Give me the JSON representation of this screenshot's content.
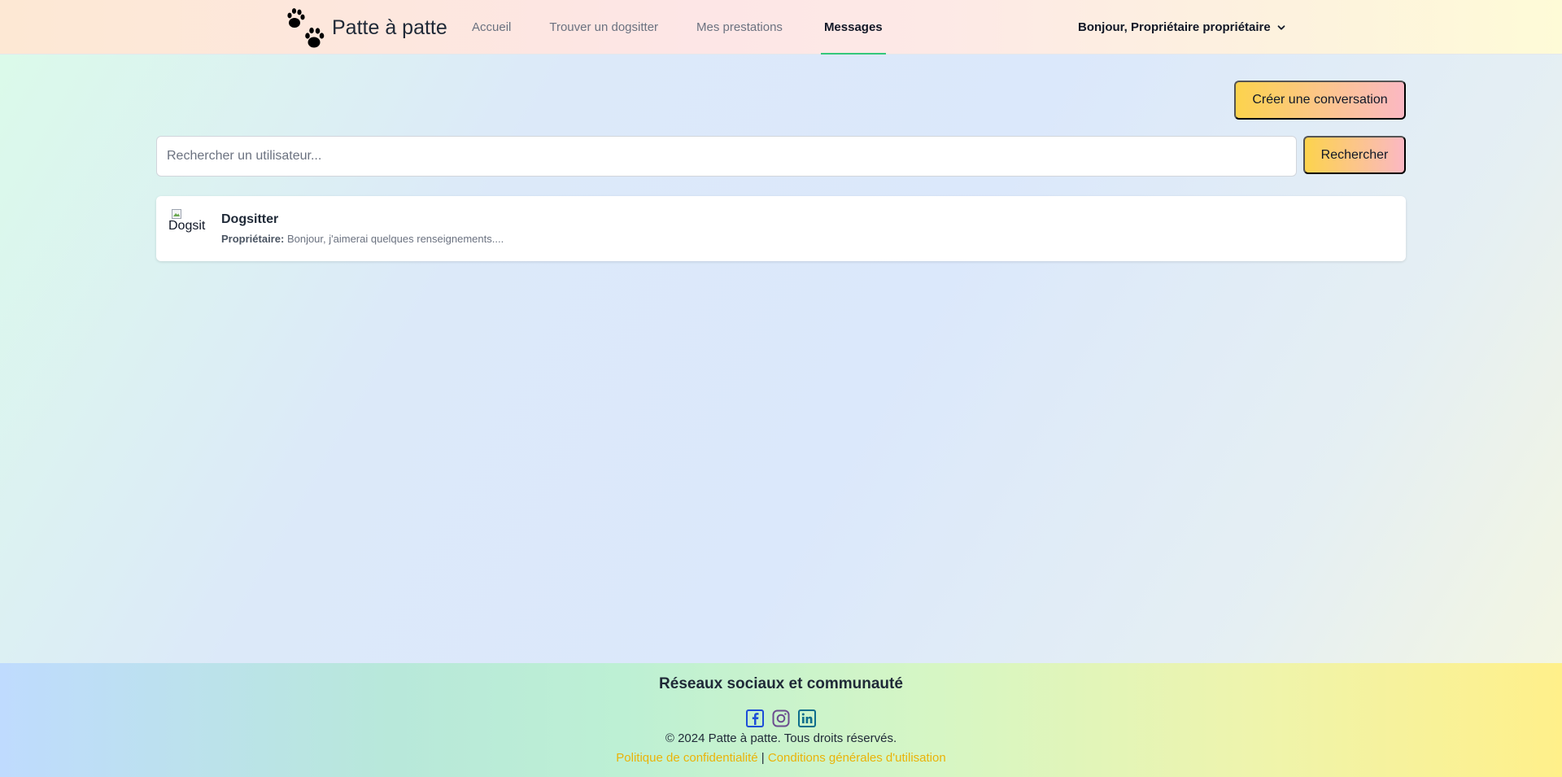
{
  "navbar": {
    "brand": "Patte à patte",
    "links": [
      {
        "label": "Accueil"
      },
      {
        "label": "Trouver un dogsitter"
      },
      {
        "label": "Mes prestations"
      },
      {
        "label": "Messages"
      }
    ],
    "active_link": "Messages",
    "user_greeting": "Bonjour, Propriétaire propriétaire"
  },
  "messages": {
    "create_button": "Créer une conversation",
    "search_placeholder": "Rechercher un utilisateur...",
    "search_button": "Rechercher",
    "conversations": [
      {
        "avatar_alt": "Dogsit",
        "name": "Dogsitter",
        "sender": "Propriétaire:",
        "preview": "Bonjour, j'aimerai quelques renseignements...."
      }
    ]
  },
  "footer": {
    "title": "Réseaux sociaux et communauté",
    "social": [
      "facebook-icon",
      "instagram-icon",
      "linkedin-icon"
    ],
    "copyright": "© 2024 Patte à patte. Tous droits réservés.",
    "privacy_link": "Politique de confidentialité",
    "separator": "|",
    "terms_link": "Conditions générales d'utilisation"
  },
  "colors": {
    "accent_active": "#34c77b",
    "button_gradient_start": "#fcd34d",
    "button_gradient_end": "#fbb8c3",
    "link": "#eab308"
  }
}
